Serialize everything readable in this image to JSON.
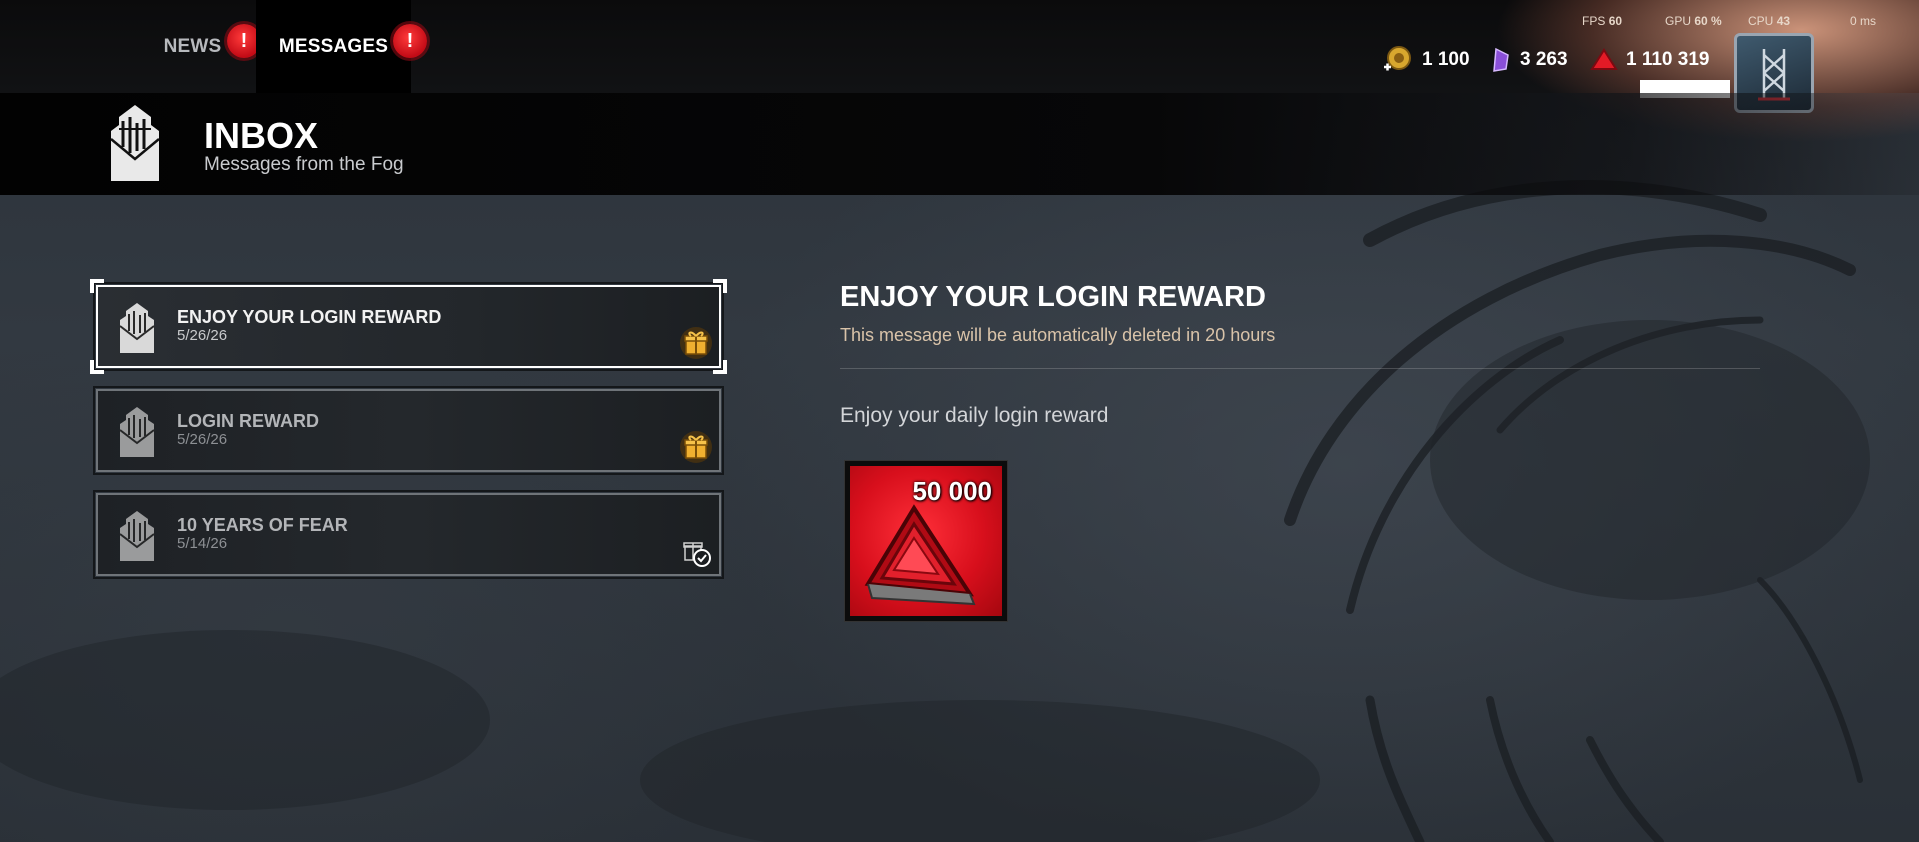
{
  "tabs": {
    "news_label": "NEWS",
    "messages_label": "MESSAGES",
    "alert_glyph": "!"
  },
  "perf": {
    "fps_label": "FPS",
    "fps_value": "60",
    "gpu_label": "GPU",
    "gpu_value": "60 %",
    "cpu_label": "CPU",
    "cpu_value": "43",
    "ms_value": "0 ms"
  },
  "currencies": [
    {
      "icon": "bloodpoints-coin-icon",
      "value": "1 100"
    },
    {
      "icon": "iridescent-shards-icon",
      "value": "3 263"
    },
    {
      "icon": "auric-cells-icon",
      "value": "1 110 319"
    }
  ],
  "inbox": {
    "title": "INBOX",
    "subtitle": "Messages from the Fog"
  },
  "messages": [
    {
      "title": "ENJOY YOUR LOGIN REWARD",
      "date": "5/26/26",
      "status_icon": "gift-icon",
      "selected": true
    },
    {
      "title": "LOGIN REWARD",
      "date": "5/26/26",
      "status_icon": "gift-icon",
      "selected": false
    },
    {
      "title": "10 YEARS OF FEAR",
      "date": "5/14/26",
      "status_icon": "claimed-gift-icon",
      "selected": false
    }
  ],
  "detail": {
    "title": "ENJOY YOUR LOGIN REWARD",
    "expiry": "This message will be automatically deleted in 20 hours",
    "body": "Enjoy your daily login reward",
    "reward_amount": "50 000",
    "reward_icon": "auric-cells-icon"
  },
  "colors": {
    "accent_red": "#d80f1c",
    "gift_gold": "#e0a22a",
    "expiry_text": "#d9c3a9"
  }
}
